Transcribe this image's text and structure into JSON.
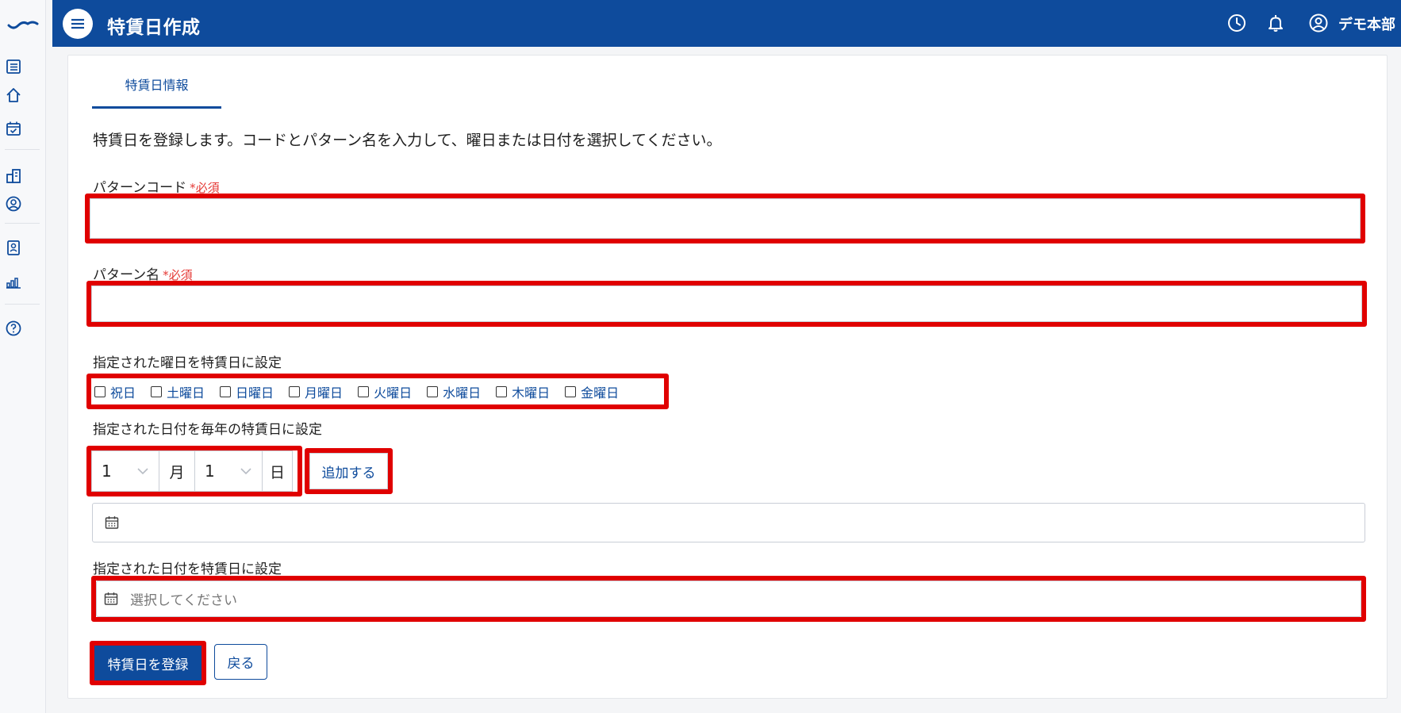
{
  "header": {
    "title": "特賃日作成",
    "user_name": "デモ本部",
    "icons": [
      "menu-icon",
      "history-icon",
      "bell-icon",
      "user-icon"
    ]
  },
  "sidebar": {
    "icons": [
      "brand-logo",
      "list-icon",
      "home-icon",
      "calendar-check-icon",
      "building-icon",
      "account-icon",
      "badge-icon",
      "bar-chart-icon",
      "help-icon"
    ]
  },
  "tabs": [
    {
      "label": "特賃日情報"
    }
  ],
  "description": "特賃日を登録します。コードとパターン名を入力して、曜日または日付を選択してください。",
  "form": {
    "pattern_code": {
      "label": "パターンコード",
      "required_mark": "*必須",
      "value": ""
    },
    "pattern_name": {
      "label": "パターン名",
      "required_mark": "*必須",
      "value": ""
    },
    "weekdays": {
      "label": "指定された曜日を特賃日に設定",
      "options": [
        "祝日",
        "土曜日",
        "日曜日",
        "月曜日",
        "火曜日",
        "水曜日",
        "木曜日",
        "金曜日"
      ]
    },
    "annual_date": {
      "label": "指定された日付を毎年の特賃日に設定",
      "month_value": "1",
      "month_unit": "月",
      "day_value": "1",
      "day_unit": "日",
      "add_label": "追加する"
    },
    "specific_date": {
      "label": "指定された日付を特賃日に設定",
      "placeholder": "選択してください"
    }
  },
  "actions": {
    "submit_label": "特賃日を登録",
    "back_label": "戻る"
  },
  "colors": {
    "brand": "#0e4b9c",
    "required": "#e53935",
    "highlight": "#e00000"
  }
}
